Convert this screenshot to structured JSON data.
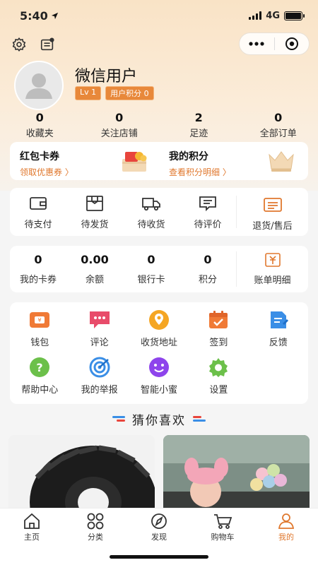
{
  "status_bar": {
    "time": "5:40",
    "network": "4G"
  },
  "user": {
    "name": "微信用户",
    "level": "Lv 1",
    "points_badge": "用户积分 0"
  },
  "stats": [
    {
      "value": "0",
      "label": "收藏夹"
    },
    {
      "value": "0",
      "label": "关注店铺"
    },
    {
      "value": "2",
      "label": "足迹"
    },
    {
      "value": "0",
      "label": "全部订单"
    }
  ],
  "promo": {
    "coupon": {
      "title": "红包卡券",
      "link": "领取优惠券 〉"
    },
    "points": {
      "title": "我的积分",
      "link": "查看积分明细 〉"
    }
  },
  "orders": [
    {
      "label": "待支付",
      "icon": "wallet-icon"
    },
    {
      "label": "待发货",
      "icon": "package-icon"
    },
    {
      "label": "待收货",
      "icon": "truck-icon"
    },
    {
      "label": "待评价",
      "icon": "comment-icon"
    }
  ],
  "order_return": {
    "label": "退货/售后",
    "icon": "return-list-icon"
  },
  "wallet": [
    {
      "value": "0",
      "label": "我的卡券"
    },
    {
      "value": "0.00",
      "label": "余额"
    },
    {
      "value": "0",
      "label": "银行卡"
    },
    {
      "value": "0",
      "label": "积分"
    }
  ],
  "bill": {
    "label": "账单明细",
    "icon": "bill-icon"
  },
  "services": [
    {
      "label": "钱包",
      "icon": "wallet-card-icon",
      "color": "#f07a36"
    },
    {
      "label": "评论",
      "icon": "chat-bubble-icon",
      "color": "#e84c6a"
    },
    {
      "label": "收货地址",
      "icon": "location-icon",
      "color": "#f5a623"
    },
    {
      "label": "签到",
      "icon": "calendar-check-icon",
      "color": "#f07a36"
    },
    {
      "label": "反馈",
      "icon": "feedback-icon",
      "color": "#3a8ee6"
    },
    {
      "label": "帮助中心",
      "icon": "help-icon",
      "color": "#6cc04a"
    },
    {
      "label": "我的举报",
      "icon": "target-icon",
      "color": "#3a8ee6"
    },
    {
      "label": "智能小蜜",
      "icon": "robot-smile-icon",
      "color": "#8e44ec"
    },
    {
      "label": "设置",
      "icon": "settings-gear-icon",
      "color": "#6cc04a"
    }
  ],
  "guess_title": "猜你喜欢",
  "tabs": [
    {
      "label": "主页",
      "icon": "home-icon",
      "active": false
    },
    {
      "label": "分类",
      "icon": "category-icon",
      "active": false
    },
    {
      "label": "发现",
      "icon": "compass-icon",
      "active": false
    },
    {
      "label": "购物车",
      "icon": "cart-icon",
      "active": false
    },
    {
      "label": "我的",
      "icon": "profile-icon",
      "active": true
    }
  ],
  "colors": {
    "accent": "#e0782e",
    "badge": "#e8883a",
    "header_bg": "#f9e3c6"
  }
}
